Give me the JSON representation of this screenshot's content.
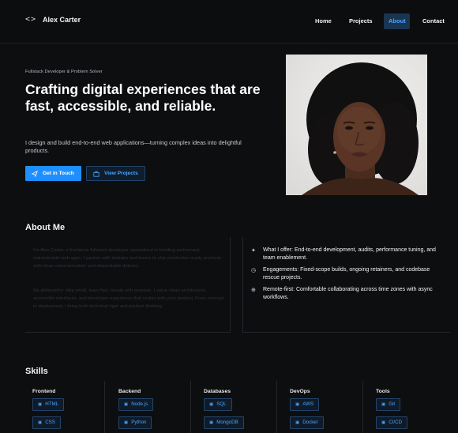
{
  "nav": {
    "brand_icon": "<>",
    "brand_name": "Alex Carter",
    "links": [
      "Home",
      "Projects",
      "About",
      "Contact"
    ],
    "active": "About"
  },
  "hero": {
    "tagline": "Fullstack Developer & Problem Solver",
    "headline": "Crafting digital experiences that are fast, accessible, and reliable.",
    "subtext": "I design and build end-to-end web applications—turning complex ideas into delightful products.",
    "primary_button": "Get in Touch",
    "secondary_button": "View Projects",
    "portrait_icon": "portrait-photo"
  },
  "about": {
    "title": "About Me",
    "paragraphs": [
      "I'm Alex Carter, a freelance fullstack developer specialized in building performant, maintainable web apps. I partner with startups and teams to ship production-ready products with clean communication and dependable delivery.",
      "My philosophy: ship small, learn fast, iterate with purpose. I value clean architecture, accessible interfaces, and developer experience that scales with your product. From concept to deployment, I bring both technical rigor and product thinking."
    ],
    "offers": [
      {
        "icon": "sparkle-icon",
        "text": "What I offer: End-to-end development, audits, performance tuning, and team enablement."
      },
      {
        "icon": "clock-icon",
        "text": "Engagements: Fixed-scope builds, ongoing retainers, and codebase rescue projects."
      },
      {
        "icon": "globe-icon",
        "text": "Remote-first: Comfortable collaborating across time zones with async workflows."
      }
    ]
  },
  "skills": {
    "title": "Skills",
    "columns": [
      {
        "name": "Frontend",
        "items": [
          "HTML",
          "CSS"
        ]
      },
      {
        "name": "Backend",
        "items": [
          "Node.js",
          "Python"
        ]
      },
      {
        "name": "Databases",
        "items": [
          "SQL",
          "MongoDB"
        ]
      },
      {
        "name": "DevOps",
        "items": [
          "AWS",
          "Docker"
        ]
      },
      {
        "name": "Tools",
        "items": [
          "Git",
          "CI/CD"
        ]
      }
    ]
  },
  "colors": {
    "background": "#0d0e10",
    "accent": "#1f8fff",
    "accent_text": "#4aa3ff"
  }
}
